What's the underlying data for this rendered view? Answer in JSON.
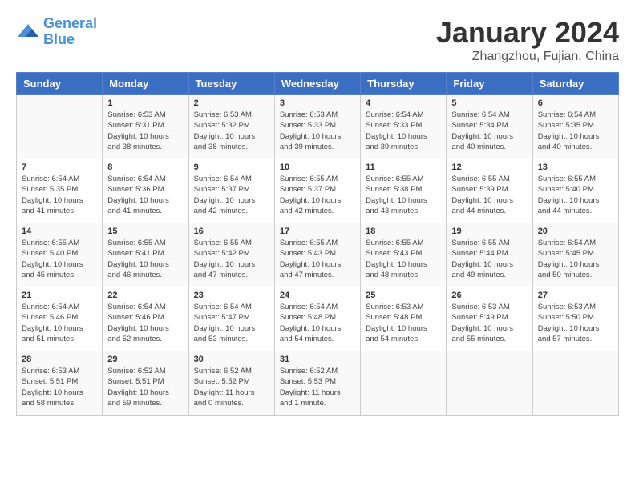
{
  "header": {
    "logo_line1": "General",
    "logo_line2": "Blue",
    "title": "January 2024",
    "subtitle": "Zhangzhou, Fujian, China"
  },
  "days_of_week": [
    "Sunday",
    "Monday",
    "Tuesday",
    "Wednesday",
    "Thursday",
    "Friday",
    "Saturday"
  ],
  "weeks": [
    [
      {
        "day": "",
        "info": ""
      },
      {
        "day": "1",
        "info": "Sunrise: 6:53 AM\nSunset: 5:31 PM\nDaylight: 10 hours\nand 38 minutes."
      },
      {
        "day": "2",
        "info": "Sunrise: 6:53 AM\nSunset: 5:32 PM\nDaylight: 10 hours\nand 38 minutes."
      },
      {
        "day": "3",
        "info": "Sunrise: 6:53 AM\nSunset: 5:33 PM\nDaylight: 10 hours\nand 39 minutes."
      },
      {
        "day": "4",
        "info": "Sunrise: 6:54 AM\nSunset: 5:33 PM\nDaylight: 10 hours\nand 39 minutes."
      },
      {
        "day": "5",
        "info": "Sunrise: 6:54 AM\nSunset: 5:34 PM\nDaylight: 10 hours\nand 40 minutes."
      },
      {
        "day": "6",
        "info": "Sunrise: 6:54 AM\nSunset: 5:35 PM\nDaylight: 10 hours\nand 40 minutes."
      }
    ],
    [
      {
        "day": "7",
        "info": "Sunrise: 6:54 AM\nSunset: 5:35 PM\nDaylight: 10 hours\nand 41 minutes."
      },
      {
        "day": "8",
        "info": "Sunrise: 6:54 AM\nSunset: 5:36 PM\nDaylight: 10 hours\nand 41 minutes."
      },
      {
        "day": "9",
        "info": "Sunrise: 6:54 AM\nSunset: 5:37 PM\nDaylight: 10 hours\nand 42 minutes."
      },
      {
        "day": "10",
        "info": "Sunrise: 6:55 AM\nSunset: 5:37 PM\nDaylight: 10 hours\nand 42 minutes."
      },
      {
        "day": "11",
        "info": "Sunrise: 6:55 AM\nSunset: 5:38 PM\nDaylight: 10 hours\nand 43 minutes."
      },
      {
        "day": "12",
        "info": "Sunrise: 6:55 AM\nSunset: 5:39 PM\nDaylight: 10 hours\nand 44 minutes."
      },
      {
        "day": "13",
        "info": "Sunrise: 6:55 AM\nSunset: 5:40 PM\nDaylight: 10 hours\nand 44 minutes."
      }
    ],
    [
      {
        "day": "14",
        "info": "Sunrise: 6:55 AM\nSunset: 5:40 PM\nDaylight: 10 hours\nand 45 minutes."
      },
      {
        "day": "15",
        "info": "Sunrise: 6:55 AM\nSunset: 5:41 PM\nDaylight: 10 hours\nand 46 minutes."
      },
      {
        "day": "16",
        "info": "Sunrise: 6:55 AM\nSunset: 5:42 PM\nDaylight: 10 hours\nand 47 minutes."
      },
      {
        "day": "17",
        "info": "Sunrise: 6:55 AM\nSunset: 5:43 PM\nDaylight: 10 hours\nand 47 minutes."
      },
      {
        "day": "18",
        "info": "Sunrise: 6:55 AM\nSunset: 5:43 PM\nDaylight: 10 hours\nand 48 minutes."
      },
      {
        "day": "19",
        "info": "Sunrise: 6:55 AM\nSunset: 5:44 PM\nDaylight: 10 hours\nand 49 minutes."
      },
      {
        "day": "20",
        "info": "Sunrise: 6:54 AM\nSunset: 5:45 PM\nDaylight: 10 hours\nand 50 minutes."
      }
    ],
    [
      {
        "day": "21",
        "info": "Sunrise: 6:54 AM\nSunset: 5:46 PM\nDaylight: 10 hours\nand 51 minutes."
      },
      {
        "day": "22",
        "info": "Sunrise: 6:54 AM\nSunset: 5:46 PM\nDaylight: 10 hours\nand 52 minutes."
      },
      {
        "day": "23",
        "info": "Sunrise: 6:54 AM\nSunset: 5:47 PM\nDaylight: 10 hours\nand 53 minutes."
      },
      {
        "day": "24",
        "info": "Sunrise: 6:54 AM\nSunset: 5:48 PM\nDaylight: 10 hours\nand 54 minutes."
      },
      {
        "day": "25",
        "info": "Sunrise: 6:53 AM\nSunset: 5:48 PM\nDaylight: 10 hours\nand 54 minutes."
      },
      {
        "day": "26",
        "info": "Sunrise: 6:53 AM\nSunset: 5:49 PM\nDaylight: 10 hours\nand 55 minutes."
      },
      {
        "day": "27",
        "info": "Sunrise: 6:53 AM\nSunset: 5:50 PM\nDaylight: 10 hours\nand 57 minutes."
      }
    ],
    [
      {
        "day": "28",
        "info": "Sunrise: 6:53 AM\nSunset: 5:51 PM\nDaylight: 10 hours\nand 58 minutes."
      },
      {
        "day": "29",
        "info": "Sunrise: 6:52 AM\nSunset: 5:51 PM\nDaylight: 10 hours\nand 59 minutes."
      },
      {
        "day": "30",
        "info": "Sunrise: 6:52 AM\nSunset: 5:52 PM\nDaylight: 11 hours\nand 0 minutes."
      },
      {
        "day": "31",
        "info": "Sunrise: 6:52 AM\nSunset: 5:53 PM\nDaylight: 11 hours\nand 1 minute."
      },
      {
        "day": "",
        "info": ""
      },
      {
        "day": "",
        "info": ""
      },
      {
        "day": "",
        "info": ""
      }
    ]
  ]
}
